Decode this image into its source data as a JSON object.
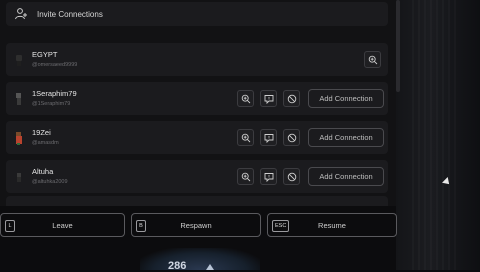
{
  "invite": {
    "label": "Invite Connections"
  },
  "players": [
    {
      "name": "EGYPT",
      "handle": "@omersaeed9999",
      "has_actions": false,
      "avatar_color": "#2a2a2a"
    },
    {
      "name": "1Seraphim79",
      "handle": "@1Seraphim79",
      "has_actions": true,
      "add_label": "Add Connection",
      "avatar_color": "#4a4a4a"
    },
    {
      "name": "19Zei",
      "handle": "@amasdm",
      "has_actions": true,
      "add_label": "Add Connection",
      "avatar_color": "#c0533a"
    },
    {
      "name": "Altuha",
      "handle": "@altuhka2009",
      "has_actions": true,
      "add_label": "Add Connection",
      "avatar_color": "#3a3a3a"
    }
  ],
  "bottom_bar": {
    "leave": {
      "key": "L",
      "label": "Leave"
    },
    "respawn": {
      "key": "B",
      "label": "Respawn"
    },
    "resume": {
      "key": "ESC",
      "label": "Resume"
    }
  },
  "hud": {
    "value": "286"
  },
  "colors": {
    "background": "#0c0c0e",
    "panel": "#121214",
    "row": "#1b1b1e",
    "border": "#5a5a5e"
  },
  "icons": [
    "add-person-icon",
    "search-plus-icon",
    "message-icon",
    "block-icon"
  ]
}
